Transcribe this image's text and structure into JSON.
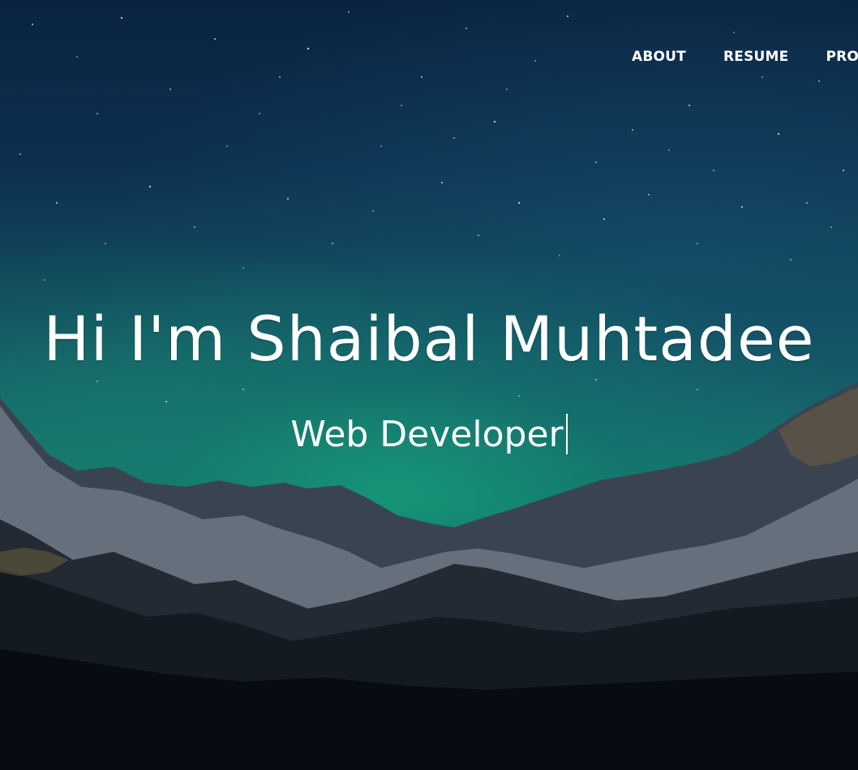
{
  "nav": {
    "items": [
      {
        "label": "ABOUT"
      },
      {
        "label": "RESUME"
      },
      {
        "label": "PROJ"
      }
    ]
  },
  "hero": {
    "headline": "Hi I'm Shaibal Muhtadee",
    "subtitle": "Web Developer"
  },
  "colors": {
    "text": "#ffffff",
    "sky_top": "#0a2340",
    "aurora": "#167a6e",
    "ground": "#05080f"
  }
}
